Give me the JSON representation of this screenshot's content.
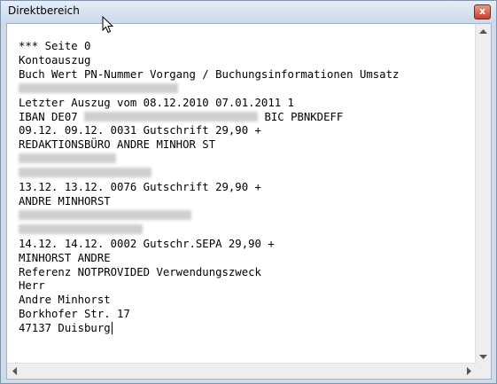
{
  "window": {
    "title": "Direktbereich"
  },
  "controls": {
    "close_symbol": "x"
  },
  "content": {
    "lines": [
      {
        "parts": [
          "*** Seite 0"
        ]
      },
      {
        "parts": [
          "Kontoauszug"
        ]
      },
      {
        "parts": [
          "Buch Wert PN-Nummer Vorgang / Buchungsinformationen Umsatz"
        ]
      },
      {
        "parts": [
          ""
        ],
        "redacted": true
      },
      {
        "parts": [
          "Letzter Auszug vom 08.12.2010 07.01.2011 1"
        ]
      },
      {
        "parts": [
          "IBAN DE07 ",
          " BIC PBNKDEFF"
        ],
        "redacted_middle": true
      },
      {
        "parts": [
          "09.12. 09.12. 0031 Gutschrift 29,90 +"
        ]
      },
      {
        "parts": [
          "REDAKTIONSBÜRO ANDRE MINHOR ST"
        ]
      },
      {
        "parts": [
          ""
        ],
        "redacted": true
      },
      {
        "parts": [
          ""
        ],
        "redacted": true
      },
      {
        "parts": [
          "13.12. 13.12. 0076 Gutschrift 29,90 +"
        ]
      },
      {
        "parts": [
          "ANDRE MINHORST"
        ]
      },
      {
        "parts": [
          ""
        ],
        "redacted": true
      },
      {
        "parts": [
          ""
        ],
        "redacted": true
      },
      {
        "parts": [
          "14.12. 14.12. 0002 Gutschr.SEPA 29,90 +"
        ]
      },
      {
        "parts": [
          "MINHORST ANDRE"
        ]
      },
      {
        "parts": [
          "Referenz NOTPROVIDED Verwendungszweck"
        ]
      },
      {
        "parts": [
          "Herr"
        ]
      },
      {
        "parts": [
          "Andre Minhorst"
        ]
      },
      {
        "parts": [
          "Borkhofer Str. 17"
        ]
      },
      {
        "parts": [
          "47137 Duisburg"
        ],
        "caret": true
      }
    ]
  },
  "icons": {
    "close": "close-icon",
    "cursor": "mouse-pointer-icon",
    "scroll_up": "arrow-up-icon",
    "scroll_down": "arrow-down-icon",
    "scroll_left": "arrow-left-icon",
    "scroll_right": "arrow-right-icon"
  }
}
